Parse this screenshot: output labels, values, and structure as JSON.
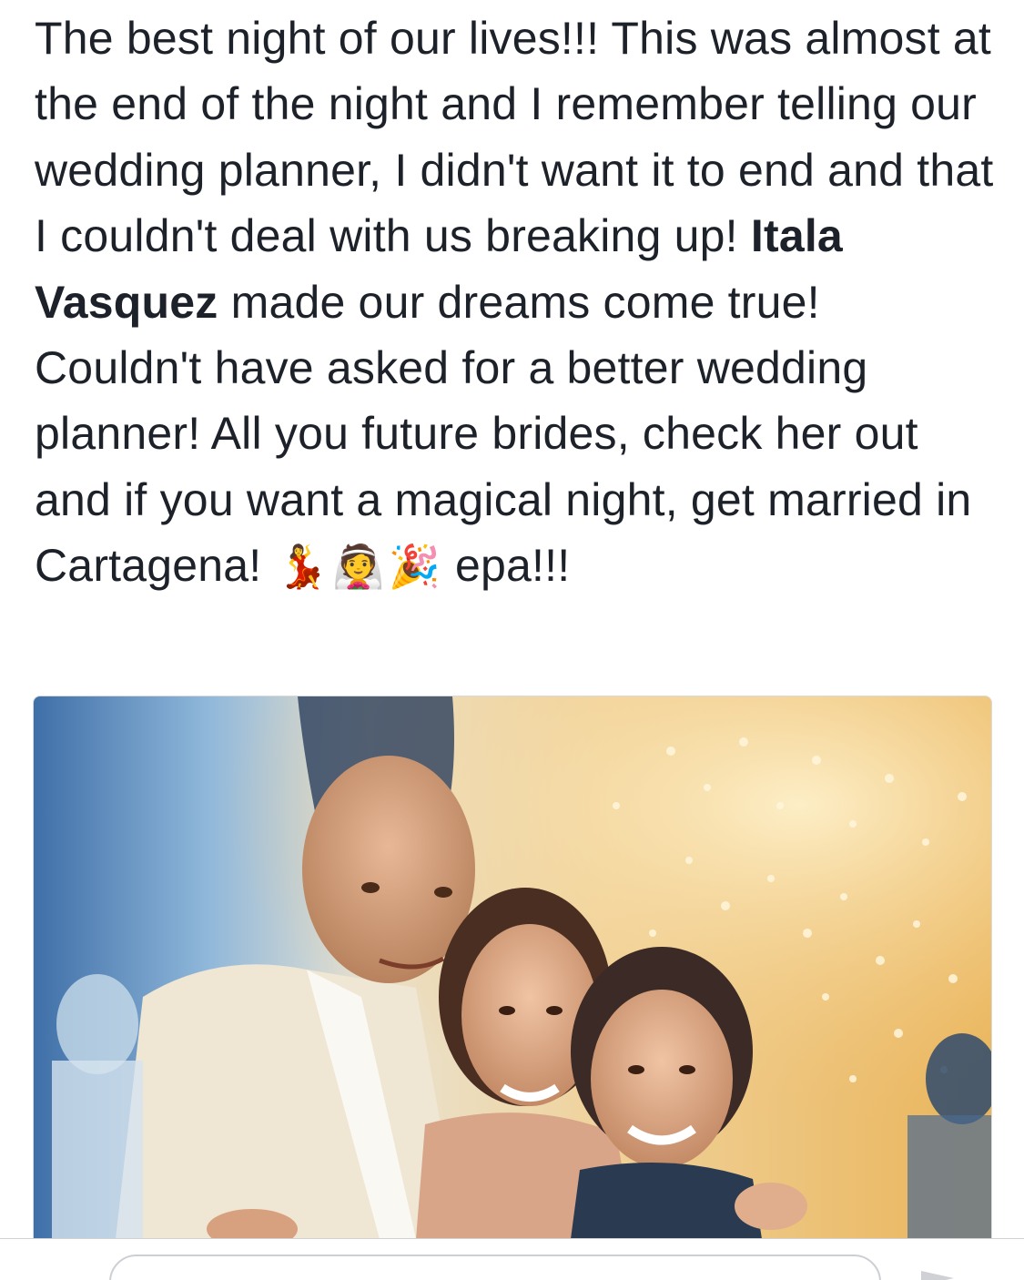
{
  "post": {
    "text_part1": "The best night of our lives!!! This was almost at the end of the night and I remember telling our wedding planner, I didn't want it to end and that I couldn't deal with us breaking up! ",
    "mention": "Itala Vasquez",
    "text_part2": " made our dreams come true! Couldn't have asked for a better wedding planner! All you future brides, check her out and if you want a magical night, get married in Cartagena! ",
    "emojis": [
      "💃",
      "👰",
      "🎉"
    ],
    "text_part3": " epa!!!"
  },
  "photo": {
    "icon": "wedding-photo"
  },
  "colors": {
    "text": "#1d2129",
    "divider": "#d0d1d5",
    "comment_border": "#ccd0d5"
  }
}
